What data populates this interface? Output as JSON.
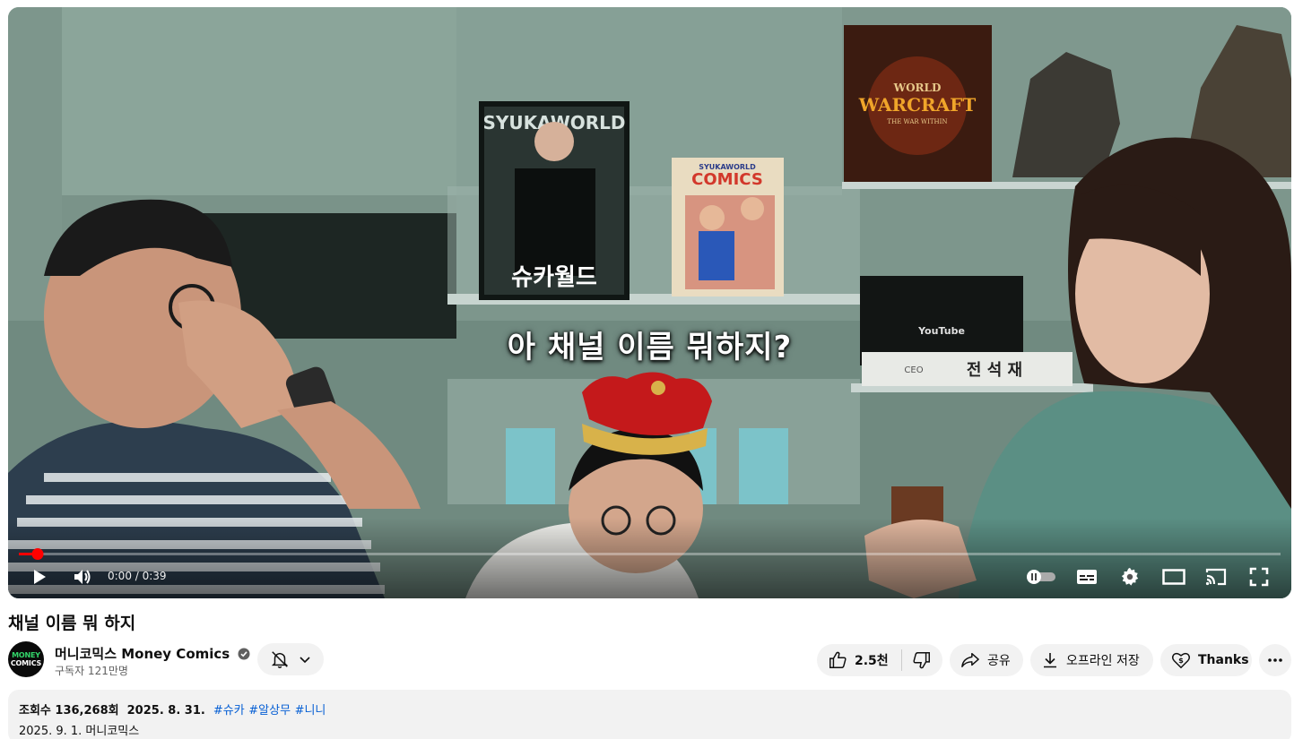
{
  "video": {
    "subtitle": "아 채널 이름 뭐하지?",
    "time_display": "0:00 / 0:39",
    "progress_fraction": 0.015,
    "scene_text": {
      "poster1_top": "SYUKAWORLD",
      "poster1_bottom": "슈카월드",
      "poster2_top": "SYUKAWORLD",
      "poster2_title": "COMICS",
      "box_logo": "YouTube",
      "game_logo_top": "WORLD",
      "game_logo_main": "WARCRAFT",
      "game_logo_sub": "THE WAR WITHIN",
      "nameplate_ceo": "CEO",
      "nameplate_name": "전 석 재"
    }
  },
  "title": "채널 이름 뭐 하지",
  "channel": {
    "avatar_line1": "MONEY",
    "avatar_line2": "COMICS",
    "name": "머니코믹스 Money Comics",
    "subscribers": "구독자 121만명"
  },
  "actions": {
    "likes": "2.5천",
    "share": "공유",
    "download": "오프라인 저장",
    "thanks": "Thanks"
  },
  "description": {
    "views": "조회수 136,268회",
    "date": "2025. 8. 31.",
    "tags": [
      "#슈카",
      "#알상무",
      "#니니"
    ],
    "line2": "2025. 9. 1. 머니코믹스"
  },
  "colors": {
    "accent_red": "#ff0000",
    "link_blue": "#065fd4",
    "pill_bg": "#f2f2f2"
  },
  "icons": {
    "play": "play-icon",
    "volume": "volume-icon",
    "autoplay": "autoplay-toggle-icon",
    "subtitles": "subtitles-icon",
    "settings": "gear-icon",
    "theater": "theater-mode-icon",
    "cast": "cast-icon",
    "fullscreen": "fullscreen-icon",
    "bell": "bell-off-icon",
    "like": "thumbs-up-icon",
    "dislike": "thumbs-down-icon",
    "share": "share-icon",
    "download": "download-icon",
    "thanks": "thanks-heart-icon",
    "more": "more-vert-icon"
  }
}
